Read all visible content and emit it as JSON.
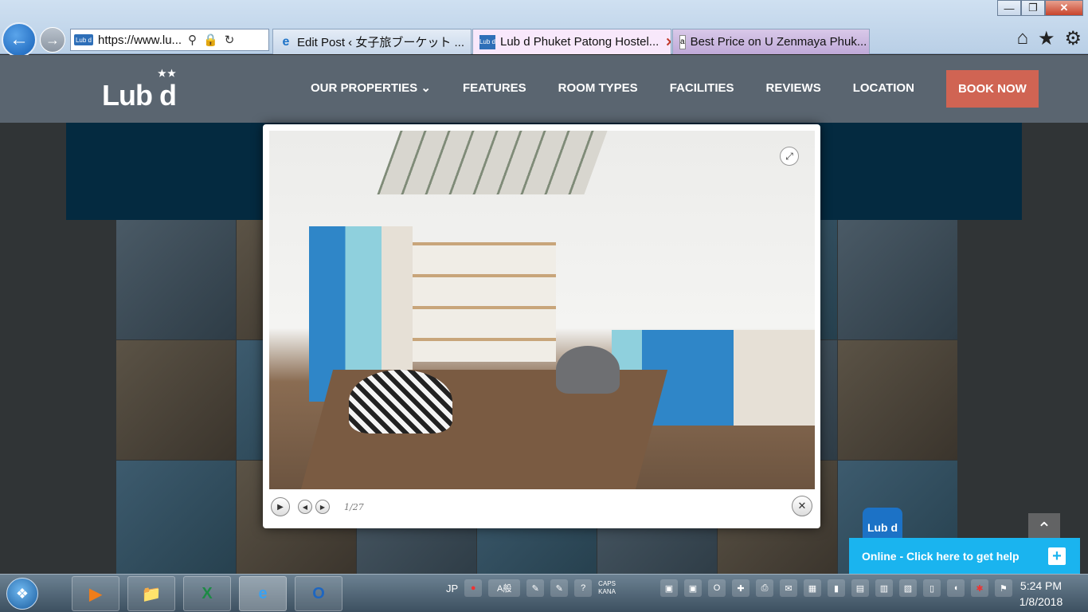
{
  "browser": {
    "title_buttons": {
      "minimize": "—",
      "restore": "❐",
      "close": "✕"
    },
    "address": "https://www.lu...",
    "address_favicon": "Lub d",
    "tabs": [
      {
        "label": "Edit Post ‹ 女子旅ブーケット ...",
        "icon": "e"
      },
      {
        "label": "Lub d Phuket Patong Hostel...",
        "icon": "Lub d",
        "close": "✕"
      },
      {
        "label": "Best Price on U Zenmaya Phuk...",
        "icon": "a"
      }
    ],
    "icons": {
      "home": "⌂",
      "favorites": "★",
      "settings": "⚙",
      "search": "⚲",
      "lock": "🔒",
      "refresh": "↻",
      "back": "←",
      "forward": "→"
    }
  },
  "site": {
    "logo": "Lub d",
    "nav": [
      {
        "label": "OUR PROPERTIES ⌄"
      },
      {
        "label": "FEATURES"
      },
      {
        "label": "ROOM TYPES"
      },
      {
        "label": "FACILITIES"
      },
      {
        "label": "REVIEWS"
      },
      {
        "label": "LOCATION"
      }
    ],
    "book_now": "BOOK NOW"
  },
  "lightbox": {
    "counter": "1/27",
    "play": "▶",
    "prev": "◀",
    "next": "▶",
    "close": "✕",
    "expand": "⤢"
  },
  "chat": {
    "logo": "Lub d",
    "text": "Online - Click here to get help",
    "plus": "+"
  },
  "totop": "⌃",
  "taskbar": {
    "lang": "JP",
    "ime": "A般",
    "caps": "CAPS",
    "kana": "KANA",
    "time": "5:24 PM",
    "date": "1/8/2018",
    "apps": [
      "▶",
      "📁",
      "X",
      "e",
      "O"
    ]
  }
}
